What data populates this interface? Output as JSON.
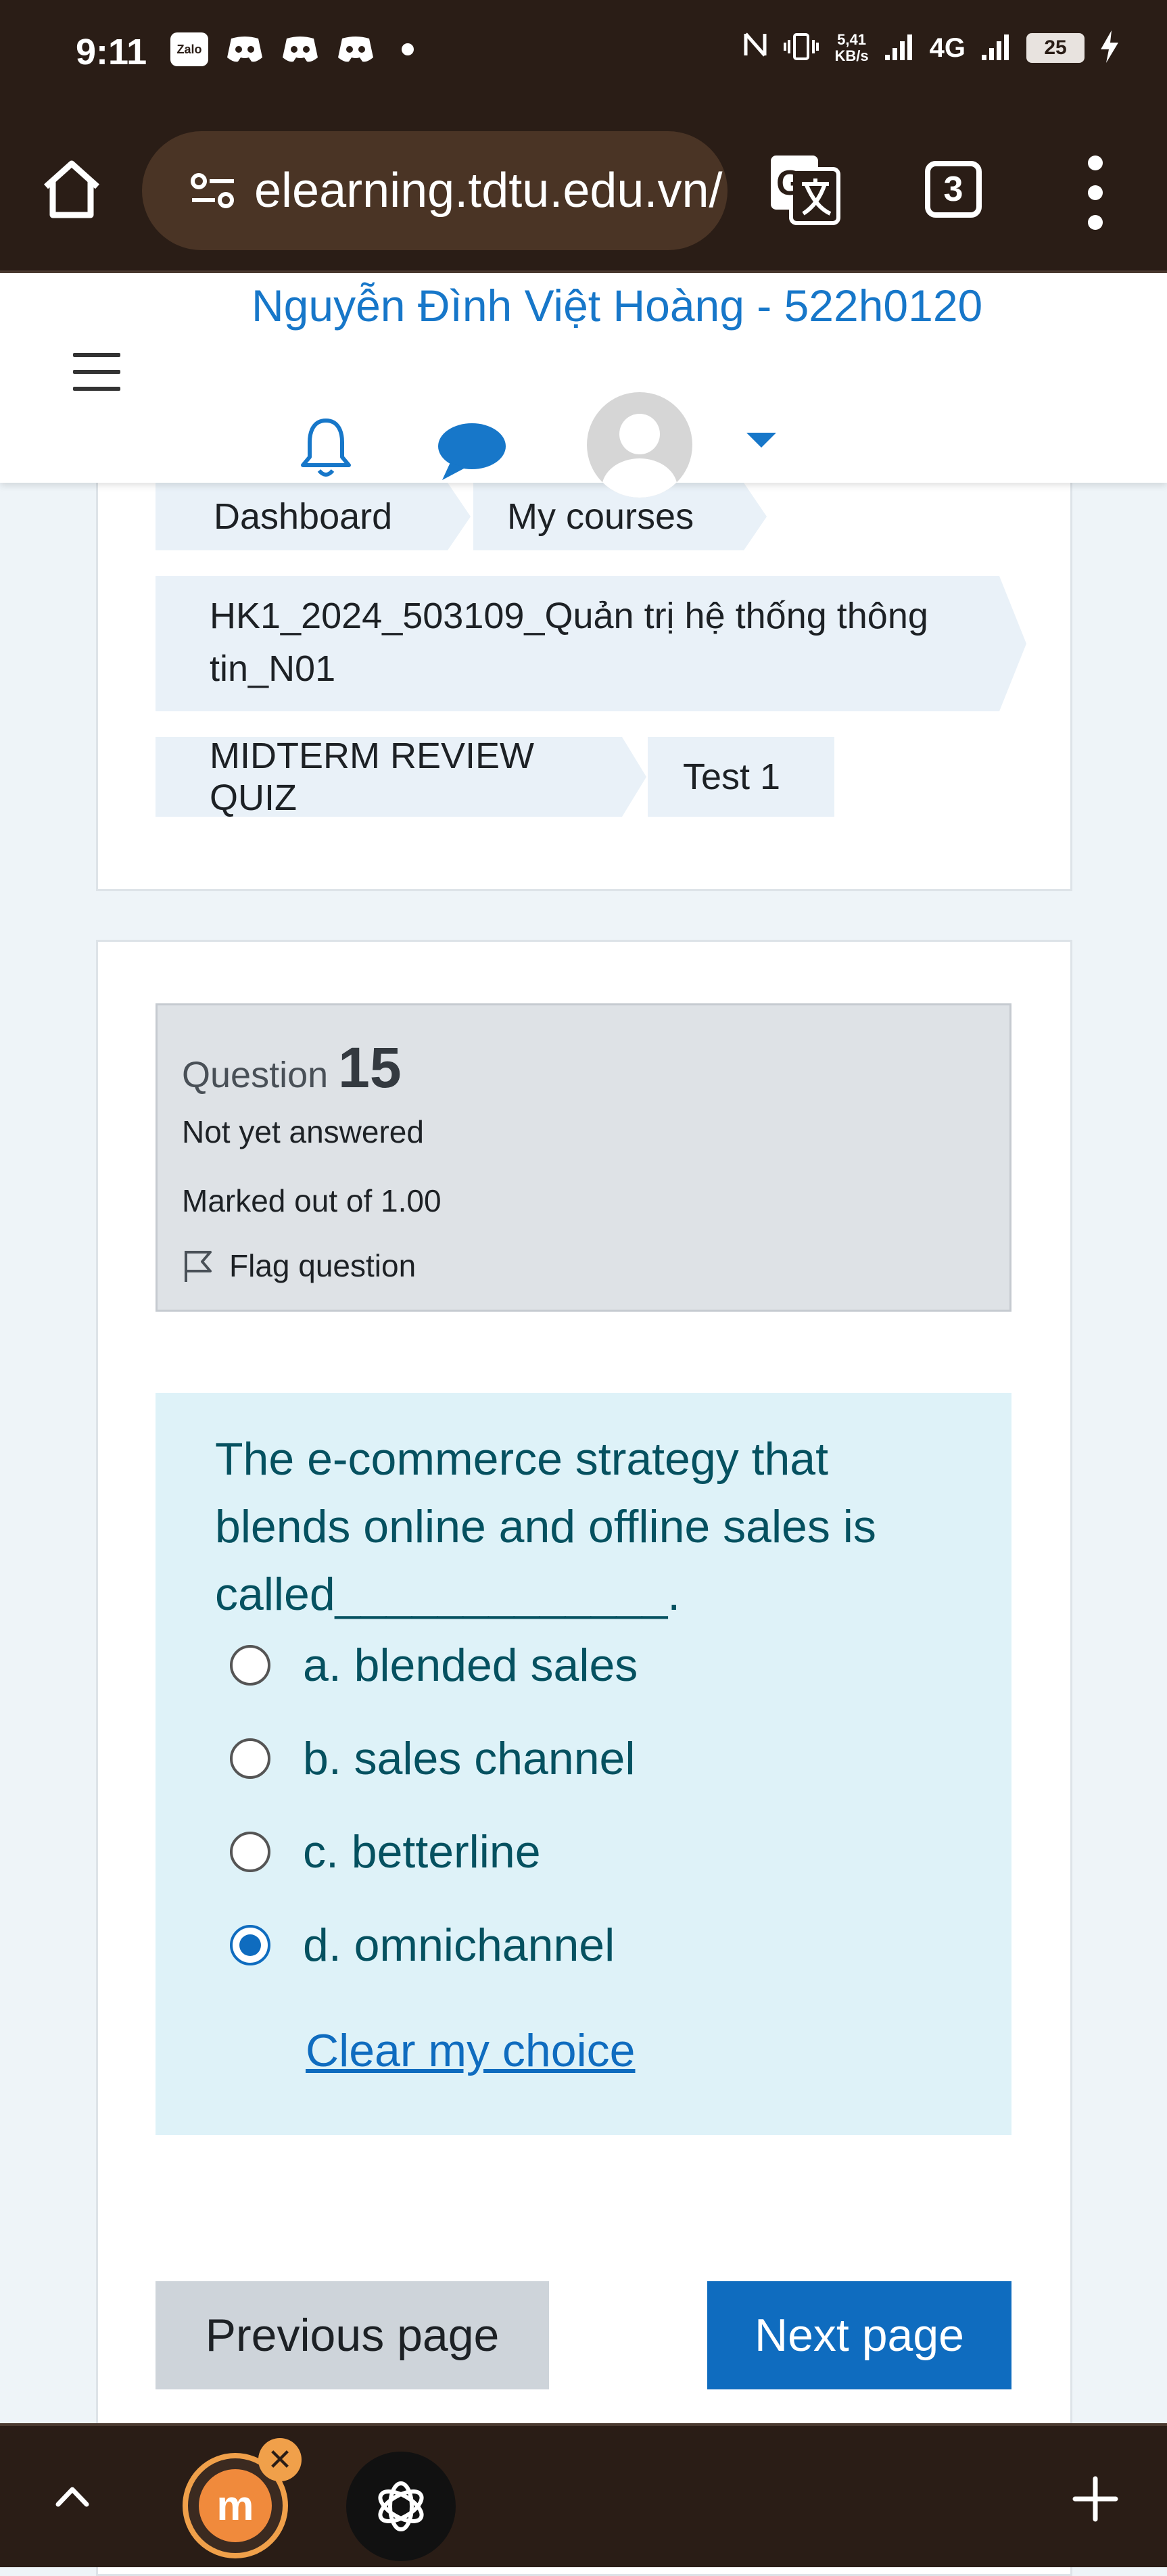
{
  "status_bar": {
    "time": "9:11",
    "app_icons": [
      "Zalo",
      "discord-icon",
      "discord-icon",
      "discord-icon"
    ],
    "net_speed_value": "5,41",
    "net_speed_unit": "KB/s",
    "network": "4G",
    "battery": "25"
  },
  "browser": {
    "url": "elearning.tdtu.edu.vn/",
    "tab_count": "3"
  },
  "header": {
    "user_name": "Nguyễn Đình Việt Hoàng - 522h0120"
  },
  "breadcrumb": {
    "items": [
      "Dashboard",
      "My courses",
      "HK1_2024_503109_Quản trị hệ thống thông",
      "tin_N01",
      "MIDTERM REVIEW QUIZ",
      "Test 1"
    ]
  },
  "question": {
    "label": "Question",
    "number": "15",
    "status": "Not yet answered",
    "marks": "Marked out of 1.00",
    "flag_label": "Flag question",
    "text_lines": [
      "The e-commerce strategy that",
      "blends online and offline sales is",
      "called_____________."
    ],
    "options": [
      {
        "label": "a. blended sales",
        "selected": false
      },
      {
        "label": "b. sales channel",
        "selected": false
      },
      {
        "label": "c. betterline",
        "selected": false
      },
      {
        "label": "d. omnichannel",
        "selected": true
      }
    ],
    "clear_label": "Clear my choice"
  },
  "navigation": {
    "prev_label": "Previous page",
    "next_label": "Next page"
  },
  "bottom_bar": {
    "app1_glyph": "m",
    "close_glyph": "✕"
  },
  "colors": {
    "accent": "#0f6cbf",
    "user_name": "#1777c9",
    "question_bg": "#def2f8",
    "question_text": "#055160",
    "browser_chrome": "#2a1d16"
  }
}
